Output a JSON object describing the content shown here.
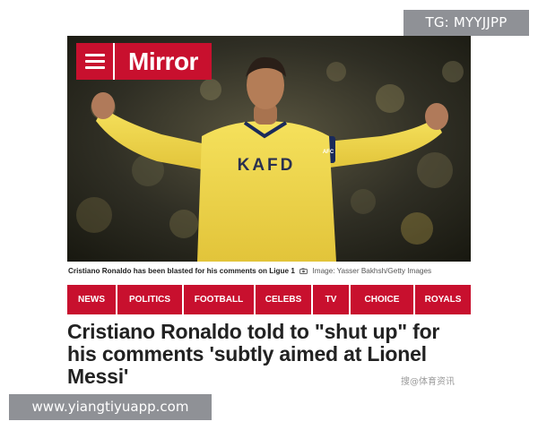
{
  "watermarks": {
    "top": "TG: MYYJJPP",
    "bottom": "www.yiangtiyuapp.com"
  },
  "article": {
    "brand": "Mirror",
    "hero": {
      "kit_text": "KAFD",
      "captain_band": "AFC"
    },
    "caption": {
      "text": "Cristiano Ronaldo has been blasted for his comments on Ligue 1",
      "credit": "Image: Yasser Bakhsh/Getty Images"
    },
    "nav": [
      {
        "label": "NEWS"
      },
      {
        "label": "POLITICS"
      },
      {
        "label": "FOOTBALL"
      },
      {
        "label": "CELEBS"
      },
      {
        "label": "TV"
      },
      {
        "label": "CHOICE"
      },
      {
        "label": "ROYALS"
      }
    ],
    "headline": "Cristiano Ronaldo told to \"shut up\" for his comments 'subtly aimed at Lionel Messi'",
    "source_stamp": "搜@体育资讯"
  },
  "colors": {
    "brand_red": "#c8102e",
    "jersey_yellow": "#f0d94a",
    "watermark_gray": "#8f9196"
  },
  "icons": [
    "menu-icon",
    "camera-icon"
  ]
}
